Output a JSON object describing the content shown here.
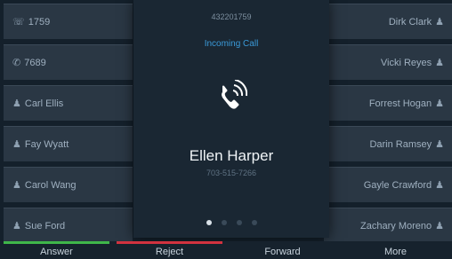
{
  "left_keys": [
    {
      "icon": "line-phone-icon",
      "glyph": "☏",
      "label": "1759"
    },
    {
      "icon": "speed-dial-icon",
      "glyph": "✆",
      "label": "7689"
    },
    {
      "icon": "contact-icon",
      "glyph": "♟",
      "label": "Carl Ellis"
    },
    {
      "icon": "contact-icon",
      "glyph": "♟",
      "label": "Fay Wyatt"
    },
    {
      "icon": "contact-icon",
      "glyph": "♟",
      "label": "Carol Wang"
    },
    {
      "icon": "contact-icon",
      "glyph": "♟",
      "label": "Sue Ford"
    }
  ],
  "right_keys": [
    {
      "icon": "contact-icon",
      "glyph": "♟",
      "label": "Dirk Clark"
    },
    {
      "icon": "contact-icon",
      "glyph": "♟",
      "label": "Vicki Reyes"
    },
    {
      "icon": "contact-icon",
      "glyph": "♟",
      "label": "Forrest Hogan"
    },
    {
      "icon": "contact-icon",
      "glyph": "♟",
      "label": "Darin Ramsey"
    },
    {
      "icon": "contact-icon",
      "glyph": "♟",
      "label": "Gayle Crawford"
    },
    {
      "icon": "contact-icon",
      "glyph": "♟",
      "label": "Zachary Moreno"
    }
  ],
  "call": {
    "number": "432201759",
    "status": "Incoming Call",
    "icon": "ringing-phone-icon",
    "caller_name": "Ellen Harper",
    "caller_number": "703-515-7266",
    "page": 1,
    "pages": 4
  },
  "softkeys": [
    {
      "label": "Answer",
      "color": "#3fb64a"
    },
    {
      "label": "Reject",
      "color": "#d2323f"
    },
    {
      "label": "Forward",
      "color": ""
    },
    {
      "label": "More",
      "color": ""
    }
  ],
  "colors": {
    "accent_blue": "#3a9ad9",
    "answer_green": "#3fb64a",
    "reject_red": "#d2323f"
  }
}
